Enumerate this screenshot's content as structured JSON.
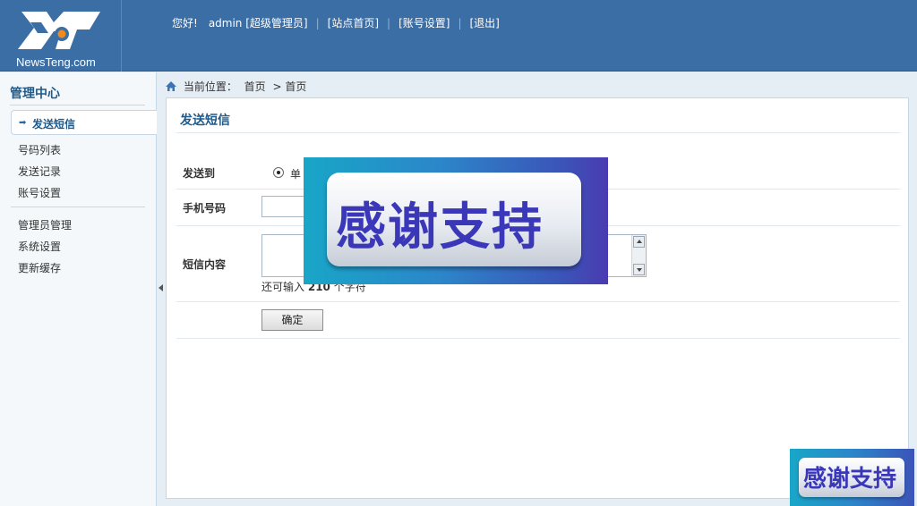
{
  "logo": {
    "text": "NewsTeng.com",
    "icon": "newsteng-logo"
  },
  "topnav": {
    "greeting": "您好!",
    "user": "admin [超级管理员]",
    "site_home": "[站点首页]",
    "account_settings": "[账号设置]",
    "logout": "[退出]"
  },
  "sidebar": {
    "title": "管理中心",
    "active_item": "发送短信",
    "items": [
      "号码列表",
      "发送记录",
      "账号设置"
    ],
    "admin_items": [
      "管理员管理",
      "系统设置",
      "更新缓存"
    ]
  },
  "breadcrumb": {
    "label": "当前位置：",
    "path": [
      "首页",
      "> 首页"
    ]
  },
  "panel": {
    "title": "发送短信",
    "send_to_label": "发送到",
    "send_to_option": "单",
    "phone_label": "手机号码",
    "phone_value": "",
    "content_label": "短信内容",
    "content_value": "",
    "counter_prefix": "还可输入",
    "counter_value": "210",
    "counter_suffix": "个字符",
    "submit_label": "确定"
  },
  "overlay": {
    "text": "感谢支持",
    "small_text": "感谢支持"
  },
  "colors": {
    "header": "#3b6ea5",
    "accent": "#1f5a8a",
    "banner_text": "#3a37b8"
  }
}
